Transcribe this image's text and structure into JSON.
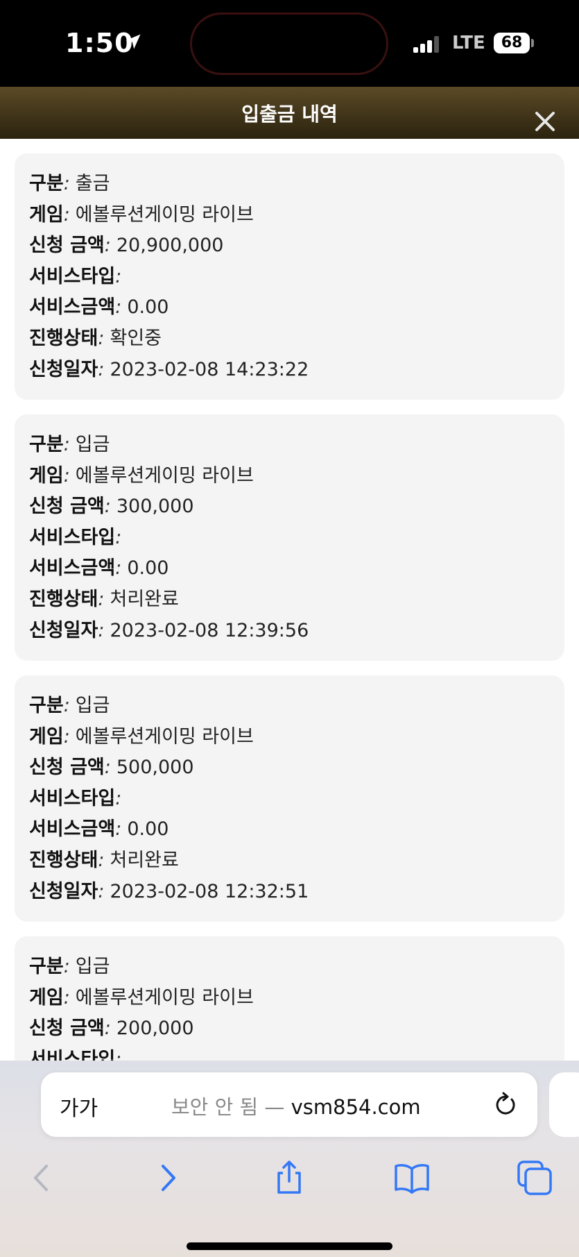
{
  "status_bar": {
    "time": "1:50",
    "network": "LTE",
    "battery": "68"
  },
  "header": {
    "title": "입출금 내역"
  },
  "field_labels": {
    "type": "구분",
    "game": "게임",
    "amount": "신청 금액",
    "service_type": "서비스타입",
    "service_amount": "서비스금액",
    "status": "진행상태",
    "date": "신청일자"
  },
  "transactions": [
    {
      "type": "출금",
      "game": "에볼루션게이밍 라이브",
      "amount": "20,900,000",
      "service_type": "",
      "service_amount": "0.00",
      "status": "확인중",
      "date": "2023-02-08 14:23:22"
    },
    {
      "type": "입금",
      "game": "에볼루션게이밍 라이브",
      "amount": "300,000",
      "service_type": "",
      "service_amount": "0.00",
      "status": "처리완료",
      "date": "2023-02-08 12:39:56"
    },
    {
      "type": "입금",
      "game": "에볼루션게이밍 라이브",
      "amount": "500,000",
      "service_type": "",
      "service_amount": "0.00",
      "status": "처리완료",
      "date": "2023-02-08 12:32:51"
    },
    {
      "type": "입금",
      "game": "에볼루션게이밍 라이브",
      "amount": "200,000",
      "service_type": "",
      "service_amount": "",
      "status": "",
      "date": ""
    }
  ],
  "browser": {
    "text_size_label": "가가",
    "security_text": "보안 안 됨 —",
    "domain": "vsm854.com"
  },
  "icons": {
    "location": "location-arrow-icon",
    "close": "close-icon",
    "reload": "reload-icon",
    "back": "chevron-left-icon",
    "forward": "chevron-right-icon",
    "share": "share-icon",
    "bookmarks": "book-icon",
    "tabs": "tabs-icon"
  },
  "colors": {
    "header_top": "#5b4a26",
    "header_bottom": "#2c2410",
    "card_bg": "#f4f4f4",
    "toolbar_blue": "#3478f6",
    "toolbar_disabled": "#b5b8c0"
  }
}
